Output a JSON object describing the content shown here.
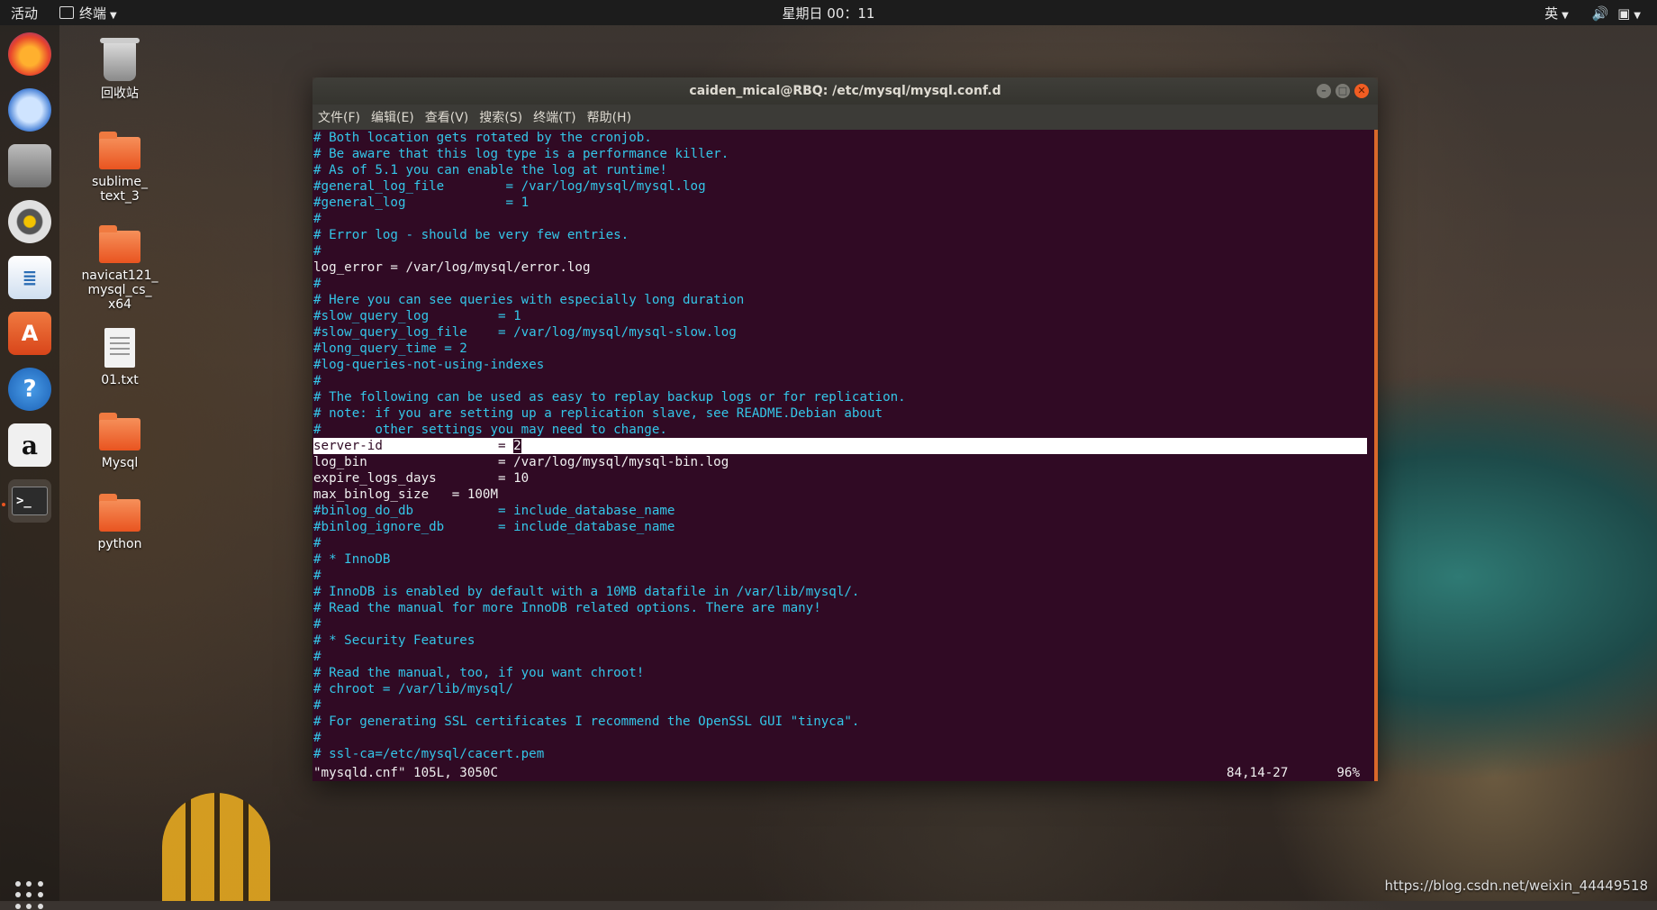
{
  "topbar": {
    "activities": "活动",
    "app_name": "终端",
    "clock": "星期日 00：11",
    "input_method": "英"
  },
  "dock": {
    "items": [
      "firefox-icon",
      "thunderbird-icon",
      "files-icon",
      "rhythmbox-icon",
      "libreoffice-writer-icon",
      "software-center-icon",
      "help-icon",
      "amazon-icon",
      "terminal-icon"
    ]
  },
  "desktop": {
    "trash": "回收站",
    "sublime": "sublime_\ntext_3",
    "navicat": "navicat121_\nmysql_cs_\nx64",
    "file01": "01.txt",
    "mysql": "Mysql",
    "python": "python"
  },
  "window": {
    "title": "caiden_mical@RBQ: /etc/mysql/mysql.conf.d",
    "menu": [
      "文件(F)",
      "编辑(E)",
      "查看(V)",
      "搜索(S)",
      "终端(T)",
      "帮助(H)"
    ]
  },
  "terminal": {
    "lines": [
      {
        "t": "# Both location gets rotated by the cronjob.",
        "c": true
      },
      {
        "t": "# Be aware that this log type is a performance killer.",
        "c": true
      },
      {
        "t": "# As of 5.1 you can enable the log at runtime!",
        "c": true
      },
      {
        "t": "#general_log_file        = /var/log/mysql/mysql.log",
        "c": true
      },
      {
        "t": "#general_log             = 1",
        "c": true
      },
      {
        "t": "#",
        "c": true
      },
      {
        "t": "# Error log - should be very few entries.",
        "c": true
      },
      {
        "t": "#",
        "c": true
      },
      {
        "t": "log_error = /var/log/mysql/error.log",
        "c": false
      },
      {
        "t": "#",
        "c": true
      },
      {
        "t": "# Here you can see queries with especially long duration",
        "c": true
      },
      {
        "t": "#slow_query_log         = 1",
        "c": true
      },
      {
        "t": "#slow_query_log_file    = /var/log/mysql/mysql-slow.log",
        "c": true
      },
      {
        "t": "#long_query_time = 2",
        "c": true
      },
      {
        "t": "#log-queries-not-using-indexes",
        "c": true
      },
      {
        "t": "#",
        "c": true
      },
      {
        "t": "# The following can be used as easy to replay backup logs or for replication.",
        "c": true
      },
      {
        "t": "# note: if you are setting up a replication slave, see README.Debian about",
        "c": true
      },
      {
        "t": "#       other settings you may need to change.",
        "c": true
      },
      {
        "t": "__HL__",
        "c": false
      },
      {
        "t": "log_bin                 = /var/log/mysql/mysql-bin.log",
        "c": false
      },
      {
        "t": "expire_logs_days        = 10",
        "c": false
      },
      {
        "t": "max_binlog_size   = 100M",
        "c": false
      },
      {
        "t": "#binlog_do_db           = include_database_name",
        "c": true
      },
      {
        "t": "#binlog_ignore_db       = include_database_name",
        "c": true
      },
      {
        "t": "#",
        "c": true
      },
      {
        "t": "# * InnoDB",
        "c": true
      },
      {
        "t": "#",
        "c": true
      },
      {
        "t": "# InnoDB is enabled by default with a 10MB datafile in /var/lib/mysql/.",
        "c": true
      },
      {
        "t": "# Read the manual for more InnoDB related options. There are many!",
        "c": true
      },
      {
        "t": "#",
        "c": true
      },
      {
        "t": "# * Security Features",
        "c": true
      },
      {
        "t": "#",
        "c": true
      },
      {
        "t": "# Read the manual, too, if you want chroot!",
        "c": true
      },
      {
        "t": "# chroot = /var/lib/mysql/",
        "c": true
      },
      {
        "t": "#",
        "c": true
      },
      {
        "t": "# For generating SSL certificates I recommend the OpenSSL GUI \"tinyca\".",
        "c": true
      },
      {
        "t": "#",
        "c": true
      },
      {
        "t": "# ssl-ca=/etc/mysql/cacert.pem",
        "c": true
      }
    ],
    "highlight_key": "server-id               = ",
    "highlight_value": "2",
    "status_file": "\"mysqld.cnf\" 105L, 3050C",
    "status_pos": "84,14-27",
    "status_pct": "96%"
  },
  "watermark": "https://blog.csdn.net/weixin_44449518"
}
